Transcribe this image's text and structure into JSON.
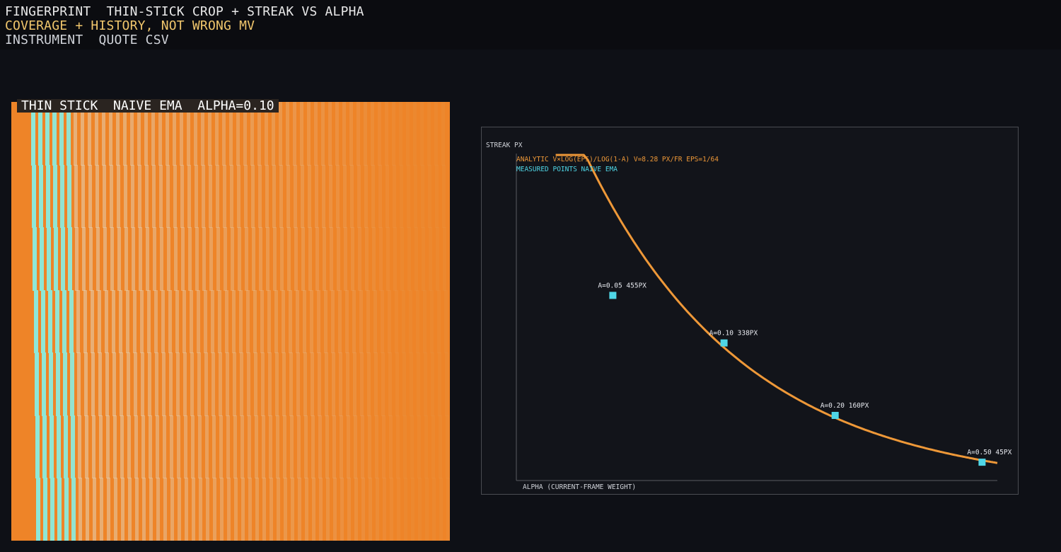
{
  "header": {
    "line1": "FINGERPRINT  THIN-STICK CROP + STREAK VS ALPHA",
    "line2": "COVERAGE + HISTORY, NOT WRONG MV",
    "line3": "INSTRUMENT  QUOTE CSV"
  },
  "crop": {
    "label": "THIN STICK  NAIVE EMA  ALPHA=0.10",
    "bg_color": "#ee8428",
    "stick_color": "#8ee8d8"
  },
  "chart_data": {
    "type": "scatter",
    "ylabel": "STREAK PX",
    "xlabel": "ALPHA  (CURRENT-FRAME WEIGHT)",
    "legend": [
      {
        "text": "ANALYTIC  V×LOG(EPS)/LOG(1-A)   V=8.28 PX/FR  EPS=1/64",
        "color": "#ee9838"
      },
      {
        "text": "MEASURED POINTS  NAIVE EMA",
        "color": "#4fd6e6"
      }
    ],
    "curve": {
      "v": 8.28,
      "eps": 0.015625,
      "color": "#ee9838"
    },
    "points": [
      {
        "alpha": 0.05,
        "streak": 455,
        "label": "A=0.05  455PX"
      },
      {
        "alpha": 0.1,
        "streak": 338,
        "label": "A=0.10  338PX"
      },
      {
        "alpha": 0.2,
        "streak": 160,
        "label": "A=0.20  160PX"
      },
      {
        "alpha": 0.5,
        "streak": 45,
        "label": "A=0.50  45PX"
      }
    ],
    "point_color": "#4fd6e6"
  }
}
